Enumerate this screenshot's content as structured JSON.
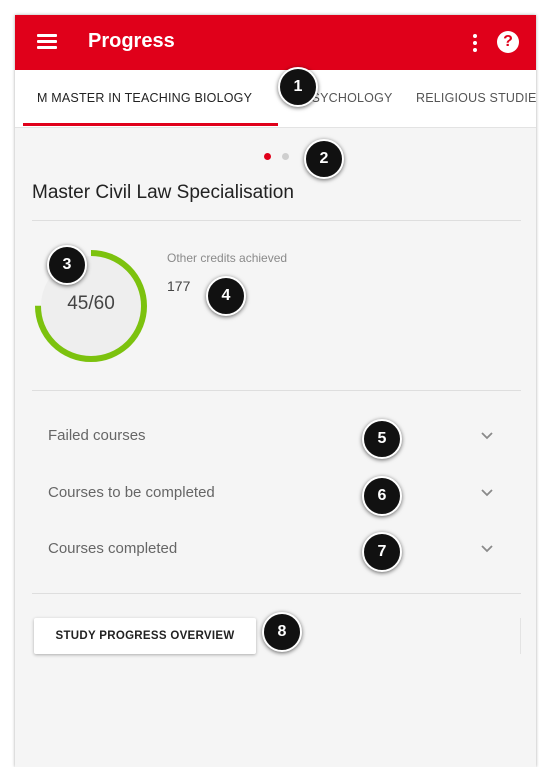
{
  "app_bar": {
    "title": "Progress",
    "bg_color": "#e0001a",
    "menu_icon": "hamburger-menu-icon",
    "overflow_icon": "more-vert-icon",
    "help_icon": "help-circle-icon",
    "help_glyph": "?"
  },
  "tabs": [
    {
      "label": "M MASTER IN TEACHING BIOLOGY",
      "active": true
    },
    {
      "label": "PSYCHOLOGY",
      "active": false
    },
    {
      "label": "RELIGIOUS STUDIE",
      "active": false
    }
  ],
  "pager": {
    "count": 2,
    "active_index": 0,
    "active_color": "#e0001a",
    "inactive_color": "#cfcfcf"
  },
  "section": {
    "title": "Master Civil Law Specialisation"
  },
  "progress": {
    "achieved": 45,
    "total": 60,
    "text": "45/60",
    "ring_color": "#7cc20e"
  },
  "other_credits": {
    "label": "Other credits achieved",
    "value": "177"
  },
  "accordions": [
    {
      "label": "Failed courses"
    },
    {
      "label": "Courses to be completed"
    },
    {
      "label": "Courses completed"
    }
  ],
  "overview_button": {
    "label": "STUDY PROGRESS OVERVIEW"
  },
  "callouts": [
    "1",
    "2",
    "3",
    "4",
    "5",
    "6",
    "7",
    "8"
  ]
}
